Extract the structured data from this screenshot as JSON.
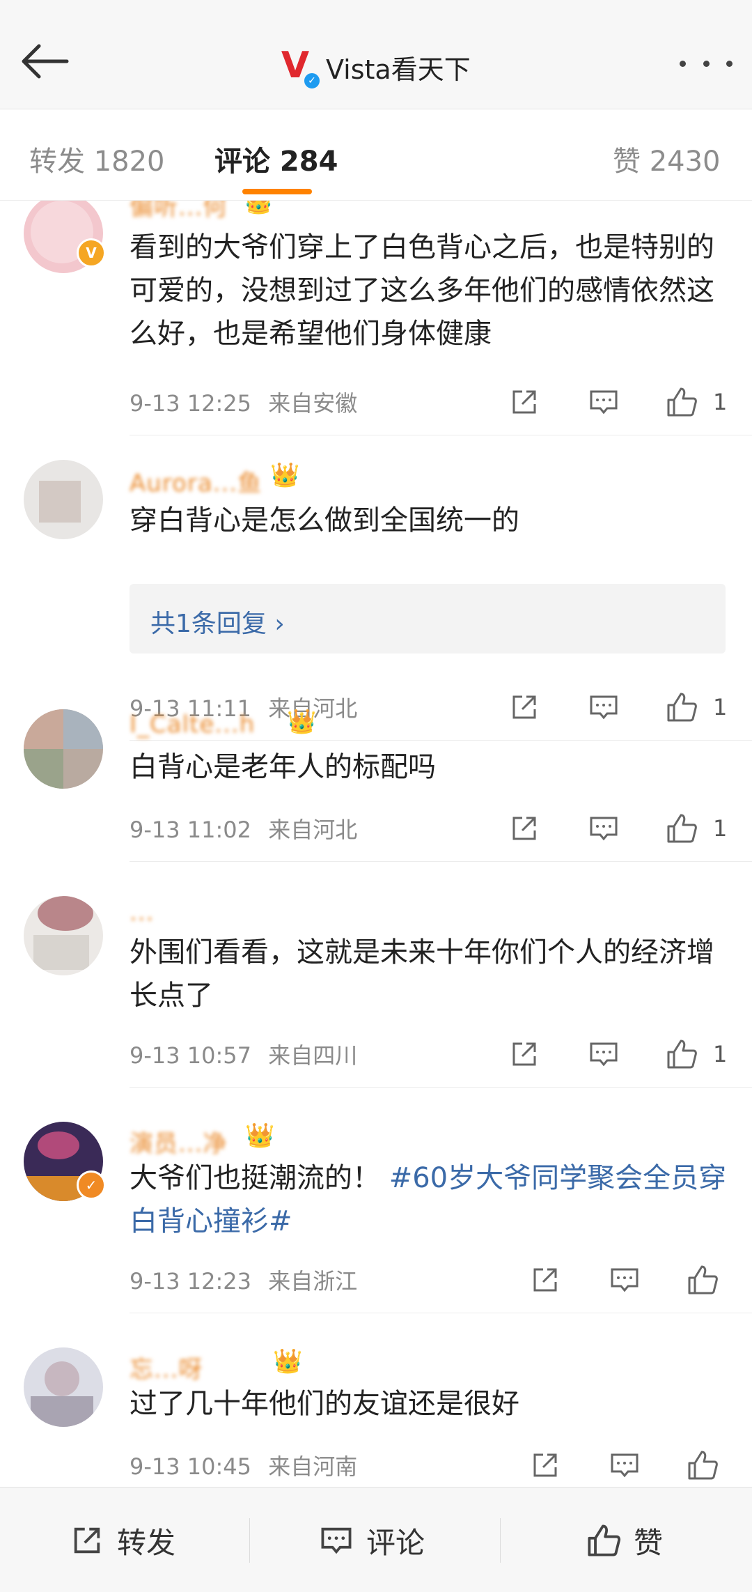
{
  "header": {
    "title": "Vista看天下",
    "logo_letter": "V",
    "verified_mark": "✓",
    "icons": {
      "back": "back-arrow-icon",
      "more": "more-dots-icon"
    }
  },
  "tabs": {
    "repost": "转发 1820",
    "comments": "评论 284",
    "likes": "赞 2430",
    "accent_color": "#ff8200"
  },
  "comments": [
    {
      "username": "偏听...何",
      "text": "看到的大爷们穿上了白色背心之后，也是特别的可爱的，没想到过了这么多年他们的感情依然这么好，也是希望他们身体健康",
      "time": "9-13 12:25",
      "location": "来自安徽",
      "likes": "1",
      "verified_mark": "V"
    },
    {
      "username": "Aurora...鱼",
      "text": "穿白背心是怎么做到全国统一的",
      "reply": "共1条回复 ›",
      "time": "9-13 11:11",
      "location": "来自河北",
      "likes": "1"
    },
    {
      "username": "I_Calte...h",
      "text": "白背心是老年人的标配吗",
      "time": "9-13 11:02",
      "location": "来自河北",
      "likes": "1"
    },
    {
      "username": "...",
      "text": "外围们看看，这就是未来十年你们个人的经济增长点了",
      "time": "9-13 10:57",
      "location": "来自四川",
      "likes": "1"
    },
    {
      "username": "演员...净",
      "text_plain": "大爷们也挺潮流的！ ",
      "text_topic": "#60岁大爷同学聚会全员穿白背心撞衫#",
      "time": "9-13 12:23",
      "location": "来自浙江",
      "likes": "",
      "verified_mark": "✓"
    },
    {
      "username": "忘...呀",
      "text": "过了几十年他们的友谊还是很好",
      "time": "9-13 10:45",
      "location": "来自河南",
      "likes": ""
    }
  ],
  "bottom_bar": {
    "repost": "转发",
    "comment": "评论",
    "like": "赞"
  },
  "colors": {
    "username": "#ea8a2c",
    "topic_link": "#3b6aa8",
    "meta": "#8a8a8a"
  }
}
